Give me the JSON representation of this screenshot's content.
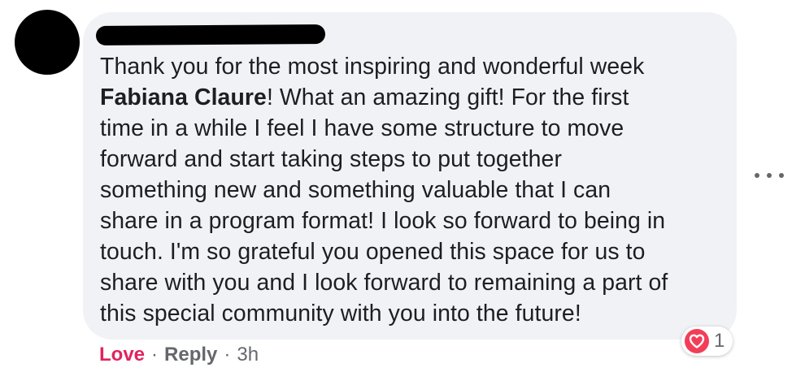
{
  "comment": {
    "text_lines": [
      "Thank you for the most inspiring and wonderful week",
      [
        "Fabiana Claure",
        "! What an amazing gift! For the first"
      ],
      "time in a while I feel I have some structure to move",
      "forward and start taking steps to put together",
      "something new and something valuable that I can",
      "share in a program format! I look so forward to being in",
      "touch. I'm so grateful you opened this space for us to",
      "share with you and I look forward to remaining a part of",
      "this special community with you into the future!"
    ]
  },
  "actions": {
    "love_label": "Love",
    "reply_label": "Reply",
    "separator": "·",
    "timestamp": "3h"
  },
  "reaction": {
    "icon": "heart-icon",
    "count": "1",
    "color": "#f33e58"
  },
  "colors": {
    "bubble": "#f0f2f5",
    "text": "#1c1e21",
    "meta": "#65676b",
    "love": "#e0245e"
  }
}
